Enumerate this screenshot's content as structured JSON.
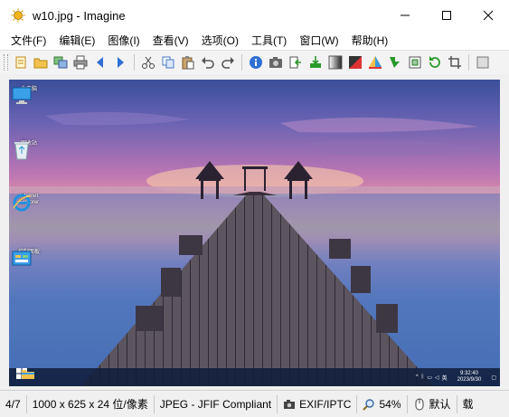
{
  "window": {
    "title": "w10.jpg - Imagine",
    "controls": {
      "minimize": "minimize",
      "maximize": "maximize",
      "close": "close"
    }
  },
  "menu": [
    "文件(F)",
    "编辑(E)",
    "图像(I)",
    "查看(V)",
    "选项(O)",
    "工具(T)",
    "窗口(W)",
    "帮助(H)"
  ],
  "toolbar": {
    "icons": [
      "new-icon",
      "open-icon",
      "copy-window-icon",
      "print-icon",
      "back-icon",
      "forward-icon",
      "cut-icon",
      "copy-icon",
      "paste-icon",
      "undo-icon",
      "redo-icon",
      "info-icon",
      "camera-icon",
      "import-icon",
      "export-icon",
      "grayscale-icon",
      "contrast-icon",
      "color-icon",
      "adjust-icon",
      "resize-icon",
      "rotate-icon",
      "crop-icon",
      "more-icon"
    ]
  },
  "desktop": {
    "icons": [
      {
        "name": "此电脑",
        "icon": "computer-icon"
      },
      {
        "name": "回收站",
        "icon": "recycle-bin-icon"
      },
      {
        "name": "Internet Explorer",
        "icon": "ie-icon"
      },
      {
        "name": "控制面板",
        "icon": "control-panel-icon"
      }
    ],
    "tray": {
      "ime": "英",
      "time": "9:32:40",
      "date": "2023/9/30"
    }
  },
  "status": {
    "index": "4/7",
    "dimensions": "1000 x 625 x 24 位/像素",
    "format": "JPEG - JFIF Compliant",
    "metadata": "EXIF/IPTC",
    "zoom": "54%",
    "mode": "默认",
    "extra": "载"
  }
}
